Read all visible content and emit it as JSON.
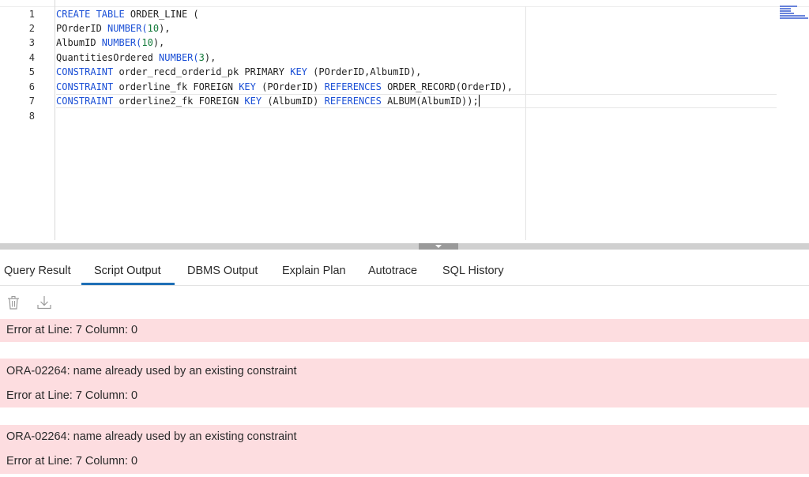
{
  "editor": {
    "line_numbers": [
      "1",
      "2",
      "3",
      "4",
      "5",
      "6",
      "7",
      "8"
    ],
    "lines": [
      [
        {
          "t": "CREATE TABLE",
          "k": "kw"
        },
        {
          "t": " ORDER_LINE (",
          "k": ""
        }
      ],
      [
        {
          "t": "POrderID ",
          "k": ""
        },
        {
          "t": "NUMBER(",
          "k": "kw"
        },
        {
          "t": "10",
          "k": "num"
        },
        {
          "t": "),",
          "k": ""
        }
      ],
      [
        {
          "t": "AlbumID ",
          "k": ""
        },
        {
          "t": "NUMBER(",
          "k": "kw"
        },
        {
          "t": "10",
          "k": "num"
        },
        {
          "t": "),",
          "k": ""
        }
      ],
      [
        {
          "t": "QuantitiesOrdered ",
          "k": ""
        },
        {
          "t": "NUMBER(",
          "k": "kw"
        },
        {
          "t": "3",
          "k": "num"
        },
        {
          "t": "),",
          "k": ""
        }
      ],
      [
        {
          "t": "CONSTRAINT",
          "k": "kw"
        },
        {
          "t": " order_recd_orderid_pk PRIMARY ",
          "k": ""
        },
        {
          "t": "KEY",
          "k": "kw"
        },
        {
          "t": " (POrderID,AlbumID),",
          "k": ""
        }
      ],
      [
        {
          "t": "CONSTRAINT",
          "k": "kw"
        },
        {
          "t": " orderline_fk FOREIGN ",
          "k": ""
        },
        {
          "t": "KEY",
          "k": "kw"
        },
        {
          "t": " (POrderID) ",
          "k": ""
        },
        {
          "t": "REFERENCES",
          "k": "kw"
        },
        {
          "t": " ORDER_RECORD(OrderID),",
          "k": ""
        }
      ],
      [
        {
          "t": "CONSTRAINT",
          "k": "kw"
        },
        {
          "t": " orderline2_fk FOREIGN ",
          "k": ""
        },
        {
          "t": "KEY",
          "k": "kw"
        },
        {
          "t": " (AlbumID) ",
          "k": ""
        },
        {
          "t": "REFERENCES",
          "k": "kw"
        },
        {
          "t": " ALBUM(AlbumID));",
          "k": ""
        }
      ],
      []
    ]
  },
  "tabs": {
    "query_result": "Query Result",
    "script_output": "Script Output",
    "dbms_output": "DBMS Output",
    "explain_plan": "Explain Plan",
    "autotrace": "Autotrace",
    "sql_history": "SQL History"
  },
  "toolbar": {
    "clear_icon": "trash-icon",
    "download_icon": "download-icon"
  },
  "output": {
    "block1": {
      "line1": "Error at Line: 7 Column: 0"
    },
    "block2": {
      "line1": "ORA-02264: name already used by an existing constraint",
      "line2": "Error at Line: 7 Column: 0"
    },
    "block3": {
      "line1": "ORA-02264: name already used by an existing constraint",
      "line2": "Error at Line: 7 Column: 0"
    }
  },
  "colors": {
    "keyword": "#1a4fd6",
    "number": "#137a3a",
    "error_background": "#fddde0",
    "active_tab_underline": "#1f6fb6"
  }
}
